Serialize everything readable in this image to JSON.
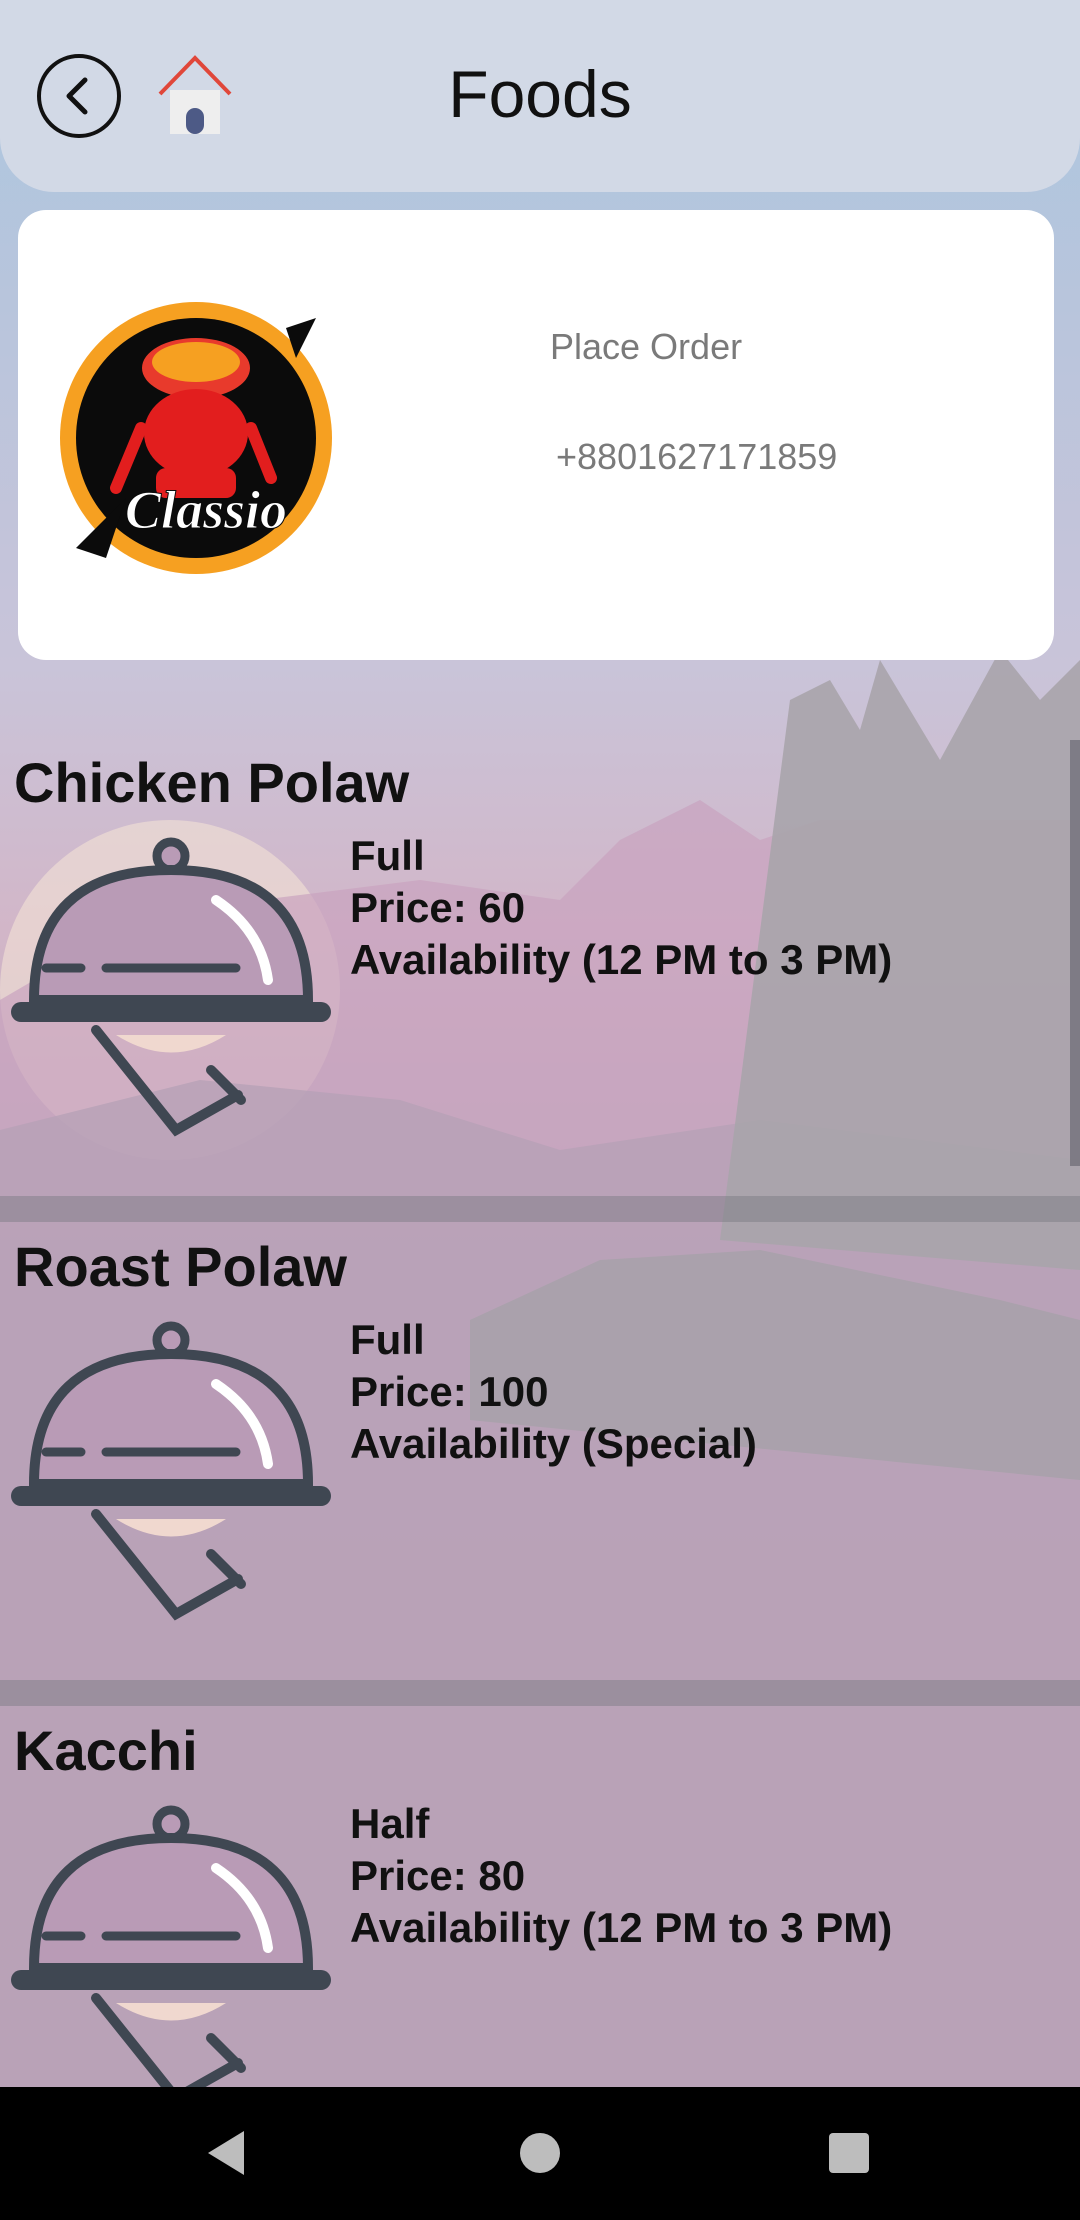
{
  "header": {
    "title": "Foods",
    "back_icon": "chevron-left-icon",
    "home_icon": "home-icon"
  },
  "shop": {
    "logo_text": "Classio",
    "place_order_label": "Place Order",
    "phone": "+8801627171859"
  },
  "foods": [
    {
      "name": "Chicken Polaw",
      "portion": "Full",
      "price": "Price: 60",
      "availability": "Availability (12 PM to 3 PM)"
    },
    {
      "name": "Roast Polaw",
      "portion": "Full",
      "price": "Price: 100",
      "availability": "Availability (Special)"
    },
    {
      "name": "Kacchi",
      "portion": "Half",
      "price": "Price: 80",
      "availability": "Availability (12 PM to 3 PM)"
    }
  ],
  "nav": {
    "back_icon": "triangle-back-icon",
    "home_icon": "circle-home-icon",
    "recents_icon": "square-recents-icon"
  },
  "colors": {
    "header_bg": "#d2d9e6",
    "card_bg": "#ffffff",
    "cloche": "#b99bb6",
    "cloche_outline": "#3f4752"
  }
}
